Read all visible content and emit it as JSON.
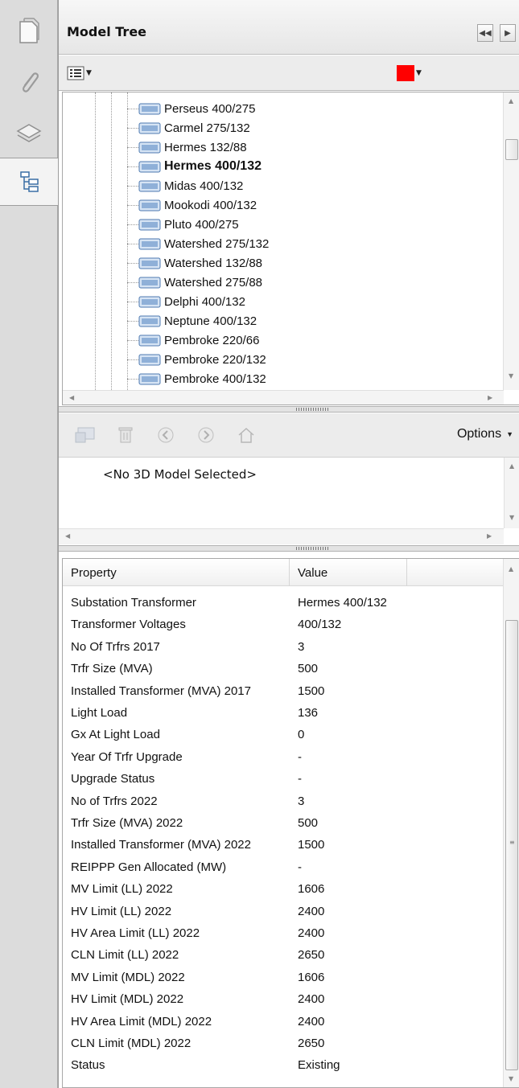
{
  "panel": {
    "title": "Model Tree",
    "nav": {
      "collapse_glyph": "◀◀",
      "next_glyph": "▶"
    },
    "toolbar": {
      "view_menu_icon": "list-view-icon",
      "highlight_color": "#ff0000"
    }
  },
  "tree": {
    "items": [
      {
        "label": "Perseus 400/275",
        "bold": false
      },
      {
        "label": "Carmel 275/132",
        "bold": false
      },
      {
        "label": "Hermes 132/88",
        "bold": false
      },
      {
        "label": "Hermes 400/132",
        "bold": true
      },
      {
        "label": "Midas 400/132",
        "bold": false
      },
      {
        "label": "Mookodi 400/132",
        "bold": false
      },
      {
        "label": "Pluto 400/275",
        "bold": false
      },
      {
        "label": "Watershed 275/132",
        "bold": false
      },
      {
        "label": "Watershed 132/88",
        "bold": false
      },
      {
        "label": "Watershed 275/88",
        "bold": false
      },
      {
        "label": "Delphi 400/132",
        "bold": false
      },
      {
        "label": "Neptune 400/132",
        "bold": false
      },
      {
        "label": "Pembroke 220/66",
        "bold": false
      },
      {
        "label": "Pembroke 220/132",
        "bold": false
      },
      {
        "label": "Pembroke 400/132",
        "bold": false
      }
    ]
  },
  "tools": {
    "options_label": "Options",
    "icons": [
      "view-icon",
      "trash-icon",
      "back-icon",
      "forward-icon",
      "home-icon"
    ]
  },
  "model_pane": {
    "message": "<No 3D Model Selected>"
  },
  "properties": {
    "headers": {
      "property": "Property",
      "value": "Value"
    },
    "rows": [
      {
        "property": "Substation Transformer",
        "value": "Hermes 400/132"
      },
      {
        "property": "Transformer Voltages",
        "value": "400/132"
      },
      {
        "property": "No Of Trfrs 2017",
        "value": "3"
      },
      {
        "property": "Trfr Size (MVA)",
        "value": "500"
      },
      {
        "property": "Installed Transformer (MVA) 2017",
        "value": "1500"
      },
      {
        "property": "Light Load",
        "value": "136"
      },
      {
        "property": "Gx At Light Load",
        "value": "0"
      },
      {
        "property": "Year Of Trfr Upgrade",
        "value": "-"
      },
      {
        "property": "Upgrade Status",
        "value": "-"
      },
      {
        "property": "No of Trfrs 2022",
        "value": "3"
      },
      {
        "property": "Trfr Size (MVA) 2022",
        "value": "500"
      },
      {
        "property": "Installed Transformer (MVA) 2022",
        "value": "1500"
      },
      {
        "property": "REIPPP Gen Allocated (MW)",
        "value": "-"
      },
      {
        "property": "MV Limit (LL) 2022",
        "value": "1606"
      },
      {
        "property": "HV Limit (LL) 2022",
        "value": "2400"
      },
      {
        "property": "HV Area Limit (LL) 2022",
        "value": "2400"
      },
      {
        "property": "CLN Limit (LL) 2022",
        "value": "2650"
      },
      {
        "property": "MV Limit (MDL) 2022",
        "value": "1606"
      },
      {
        "property": "HV Limit (MDL) 2022",
        "value": "2400"
      },
      {
        "property": "HV Area Limit (MDL) 2022",
        "value": "2400"
      },
      {
        "property": "CLN Limit (MDL) 2022",
        "value": "2650"
      },
      {
        "property": "Status",
        "value": "Existing"
      }
    ]
  }
}
